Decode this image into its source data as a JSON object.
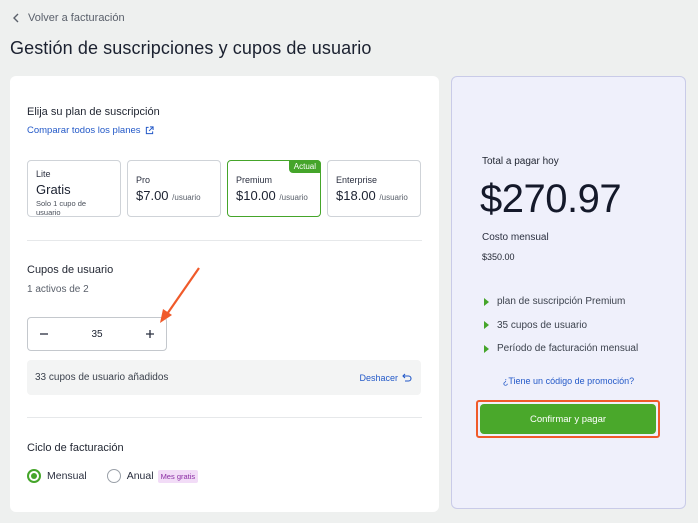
{
  "header": {
    "back_label": "Volver a facturación",
    "title": "Gestión de suscripciones y cupos de usuario"
  },
  "plan_section": {
    "title": "Elija su plan de suscripción",
    "compare_link": "Comparar todos los planes",
    "plans": [
      {
        "name": "Lite",
        "price": "Gratis",
        "per": "",
        "note": "Solo 1 cupo de usuario"
      },
      {
        "name": "Pro",
        "price": "$7.00",
        "per": "/usuario",
        "note": ""
      },
      {
        "name": "Premium",
        "price": "$10.00",
        "per": "/usuario",
        "note": "",
        "badge": "Actual"
      },
      {
        "name": "Enterprise",
        "price": "$18.00",
        "per": "/usuario",
        "note": ""
      }
    ]
  },
  "seats_section": {
    "title": "Cupos de usuario",
    "active_text": "1 activos de 2",
    "stepper_value": "35",
    "added_text": "33 cupos de usuario añadidos",
    "undo_label": "Deshacer"
  },
  "billing_section": {
    "title": "Ciclo de facturación",
    "options": [
      {
        "label": "Mensual",
        "checked": true
      },
      {
        "label": "Anual",
        "checked": false,
        "badge": "Mes gratis"
      }
    ]
  },
  "summary": {
    "label": "Total a pagar hoy",
    "total": "$270.97",
    "monthly_label": "Costo mensual",
    "monthly_value": "$350.00",
    "items": [
      "plan de suscripción Premium",
      "35 cupos de usuario",
      "Período de facturación mensual"
    ],
    "promo_link": "¿Tiene un código de promoción?",
    "confirm_label": "Confirmar y pagar"
  },
  "colors": {
    "accent_green": "#45a52a",
    "link_blue": "#2359c8",
    "highlight_orange": "#f05a2a"
  }
}
